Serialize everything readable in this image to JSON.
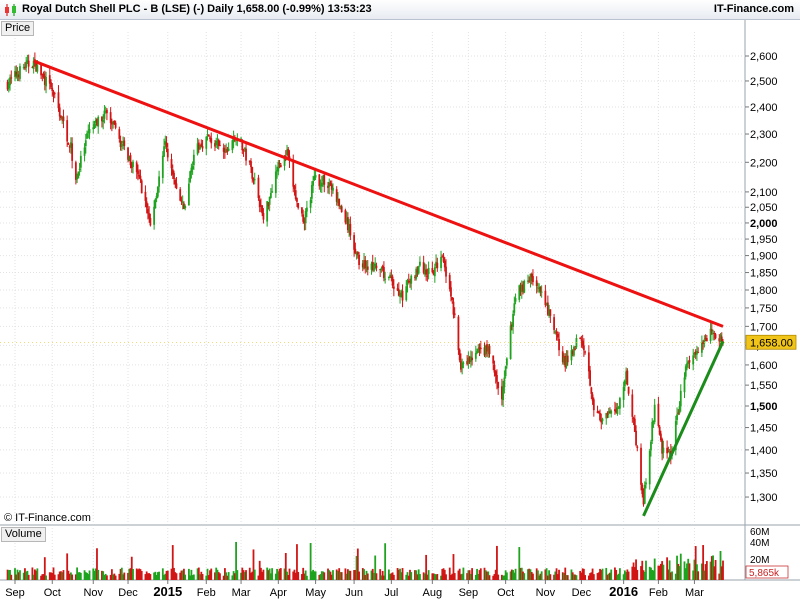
{
  "header": {
    "title": "Royal Dutch Shell PLC - B (LSE) (-)   Daily   1,658.00 (-0.99%)   13:53:23",
    "brand": "IT-Finance.com"
  },
  "panels": {
    "price_label": "Price",
    "volume_label": "Volume"
  },
  "watermark": "© IT-Finance.com",
  "colors": {
    "up": "#1fa31f",
    "down": "#d11414",
    "resistance": "#ee1111",
    "support": "#1a8c1a",
    "last_badge": "#f0c419"
  },
  "chart_data": {
    "type": "candlestick",
    "title": "Royal Dutch Shell PLC - B (LSE) (-)",
    "period": "Daily",
    "last_price": 1658.0,
    "last_price_label": "1,658.00",
    "change_pct": "-0.99%",
    "time": "13:53:23",
    "y_axis": {
      "scale": "log",
      "ylim": [
        1250,
        2700
      ],
      "ticks": [
        {
          "v": 2600,
          "label": "2,600",
          "bold": false
        },
        {
          "v": 2500,
          "label": "2,500",
          "bold": false
        },
        {
          "v": 2400,
          "label": "2,400",
          "bold": false
        },
        {
          "v": 2300,
          "label": "2,300",
          "bold": false
        },
        {
          "v": 2200,
          "label": "2,200",
          "bold": false
        },
        {
          "v": 2100,
          "label": "2,100",
          "bold": false
        },
        {
          "v": 2050,
          "label": "2,050",
          "bold": false
        },
        {
          "v": 2000,
          "label": "2,000",
          "bold": true
        },
        {
          "v": 1950,
          "label": "1,950",
          "bold": false
        },
        {
          "v": 1900,
          "label": "1,900",
          "bold": false
        },
        {
          "v": 1850,
          "label": "1,850",
          "bold": false
        },
        {
          "v": 1800,
          "label": "1,800",
          "bold": false
        },
        {
          "v": 1750,
          "label": "1,750",
          "bold": false
        },
        {
          "v": 1700,
          "label": "1,700",
          "bold": false
        },
        {
          "v": 1650,
          "label": "1,650",
          "bold": false
        },
        {
          "v": 1600,
          "label": "1,600",
          "bold": false
        },
        {
          "v": 1550,
          "label": "1,550",
          "bold": false
        },
        {
          "v": 1500,
          "label": "1,500",
          "bold": true
        },
        {
          "v": 1450,
          "label": "1,450",
          "bold": false
        },
        {
          "v": 1400,
          "label": "1,400",
          "bold": false
        },
        {
          "v": 1350,
          "label": "1,350",
          "bold": false
        },
        {
          "v": 1300,
          "label": "1,300",
          "bold": false
        }
      ]
    },
    "x_axis": {
      "start": "2014-09-01",
      "end": "2016-03-24",
      "ticks": [
        {
          "d": "2014-09-01",
          "label": "Sep",
          "bold": false
        },
        {
          "d": "2014-10-01",
          "label": "Oct",
          "bold": false
        },
        {
          "d": "2014-11-03",
          "label": "Nov",
          "bold": false
        },
        {
          "d": "2014-12-01",
          "label": "Dec",
          "bold": false
        },
        {
          "d": "2015-01-02",
          "label": "2015",
          "bold": true
        },
        {
          "d": "2015-02-02",
          "label": "Feb",
          "bold": false
        },
        {
          "d": "2015-03-02",
          "label": "Mar",
          "bold": false
        },
        {
          "d": "2015-04-01",
          "label": "Apr",
          "bold": false
        },
        {
          "d": "2015-05-01",
          "label": "May",
          "bold": false
        },
        {
          "d": "2015-06-01",
          "label": "Jun",
          "bold": false
        },
        {
          "d": "2015-07-01",
          "label": "Jul",
          "bold": false
        },
        {
          "d": "2015-08-03",
          "label": "Aug",
          "bold": false
        },
        {
          "d": "2015-09-01",
          "label": "Sep",
          "bold": false
        },
        {
          "d": "2015-10-01",
          "label": "Oct",
          "bold": false
        },
        {
          "d": "2015-11-02",
          "label": "Nov",
          "bold": false
        },
        {
          "d": "2015-12-01",
          "label": "Dec",
          "bold": false
        },
        {
          "d": "2016-01-04",
          "label": "2016",
          "bold": true
        },
        {
          "d": "2016-02-01",
          "label": "Feb",
          "bold": false
        },
        {
          "d": "2016-03-01",
          "label": "Mar",
          "bold": false
        }
      ]
    },
    "price_path": [
      [
        "2014-08-26",
        2490
      ],
      [
        "2014-09-08",
        2555
      ],
      [
        "2014-09-16",
        2575
      ],
      [
        "2014-10-02",
        2450
      ],
      [
        "2014-10-16",
        2250
      ],
      [
        "2014-10-20",
        2140
      ],
      [
        "2014-10-30",
        2300
      ],
      [
        "2014-11-13",
        2380
      ],
      [
        "2014-11-24",
        2280
      ],
      [
        "2014-12-09",
        2160
      ],
      [
        "2014-12-16",
        2050
      ],
      [
        "2014-12-19",
        1990
      ],
      [
        "2014-12-31",
        2260
      ],
      [
        "2015-01-08",
        2120
      ],
      [
        "2015-01-15",
        2040
      ],
      [
        "2015-01-23",
        2230
      ],
      [
        "2015-02-03",
        2290
      ],
      [
        "2015-02-17",
        2230
      ],
      [
        "2015-02-27",
        2300
      ],
      [
        "2015-03-13",
        2140
      ],
      [
        "2015-03-20",
        2010
      ],
      [
        "2015-03-31",
        2180
      ],
      [
        "2015-04-08",
        2230
      ],
      [
        "2015-04-16",
        2060
      ],
      [
        "2015-04-22",
        2010
      ],
      [
        "2015-04-30",
        2140
      ],
      [
        "2015-05-12",
        2130
      ],
      [
        "2015-05-26",
        2000
      ],
      [
        "2015-06-05",
        1880
      ],
      [
        "2015-06-19",
        1860
      ],
      [
        "2015-06-30",
        1830
      ],
      [
        "2015-07-09",
        1780
      ],
      [
        "2015-07-23",
        1870
      ],
      [
        "2015-08-03",
        1840
      ],
      [
        "2015-08-11",
        1910
      ],
      [
        "2015-08-21",
        1720
      ],
      [
        "2015-08-26",
        1590
      ],
      [
        "2015-09-08",
        1630
      ],
      [
        "2015-09-17",
        1640
      ],
      [
        "2015-09-28",
        1510
      ],
      [
        "2015-10-09",
        1790
      ],
      [
        "2015-10-22",
        1840
      ],
      [
        "2015-11-02",
        1760
      ],
      [
        "2015-11-13",
        1650
      ],
      [
        "2015-11-18",
        1600
      ],
      [
        "2015-11-30",
        1680
      ],
      [
        "2015-12-04",
        1640
      ],
      [
        "2015-12-11",
        1500
      ],
      [
        "2015-12-17",
        1460
      ],
      [
        "2015-12-31",
        1500
      ],
      [
        "2016-01-06",
        1580
      ],
      [
        "2016-01-13",
        1440
      ],
      [
        "2016-01-20",
        1290
      ],
      [
        "2016-01-29",
        1500
      ],
      [
        "2016-02-04",
        1400
      ],
      [
        "2016-02-11",
        1380
      ],
      [
        "2016-02-22",
        1580
      ],
      [
        "2016-03-03",
        1640
      ],
      [
        "2016-03-15",
        1690
      ],
      [
        "2016-03-22",
        1670
      ],
      [
        "2016-03-24",
        1658
      ]
    ],
    "resistance_line": {
      "start": [
        "2014-09-16",
        2580
      ],
      "end": [
        "2016-03-24",
        1700
      ]
    },
    "support_line": {
      "start": [
        "2016-01-20",
        1262
      ],
      "end": [
        "2016-03-24",
        1660
      ]
    },
    "volume": {
      "axis_labels": [
        "60M",
        "40M",
        "20M"
      ],
      "last_label": "5,865k"
    }
  }
}
